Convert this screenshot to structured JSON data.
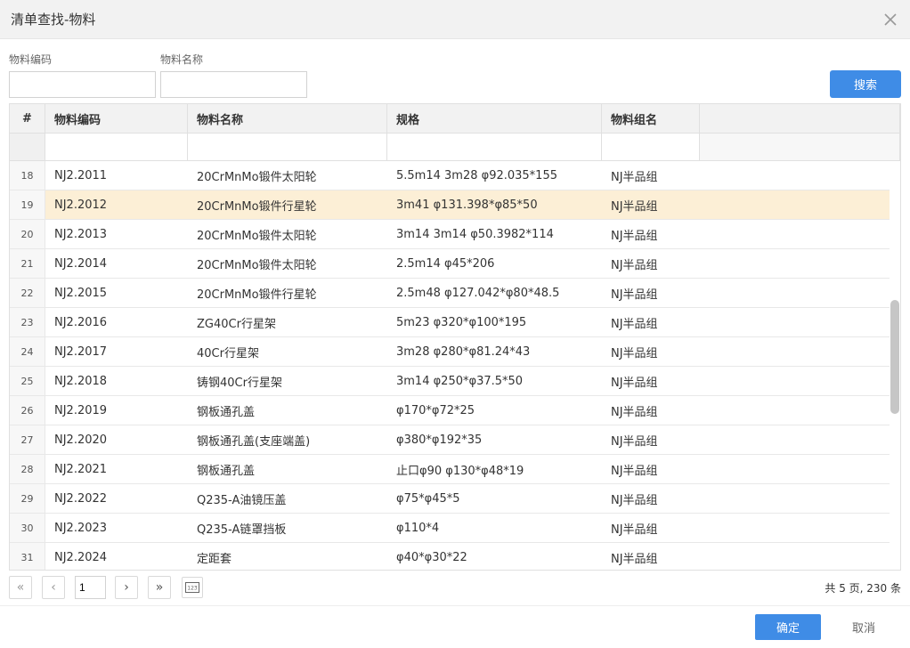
{
  "dialog": {
    "title": "清单查找-物料"
  },
  "filters": {
    "code_label": "物料编码",
    "code_value": "",
    "name_label": "物料名称",
    "name_value": "",
    "search_label": "搜索"
  },
  "table": {
    "columns": [
      "#",
      "物料编码",
      "物料名称",
      "规格",
      "物料组名"
    ],
    "rows": [
      {
        "no": "18",
        "code": "NJ2.2011",
        "name": "20CrMnMo锻件太阳轮",
        "spec": "5.5m14 3m28 φ92.035*155",
        "group": "NJ半品组"
      },
      {
        "no": "19",
        "code": "NJ2.2012",
        "name": "20CrMnMo锻件行星轮",
        "spec": "3m41 φ131.398*φ85*50",
        "group": "NJ半品组",
        "selected": true
      },
      {
        "no": "20",
        "code": "NJ2.2013",
        "name": "20CrMnMo锻件太阳轮",
        "spec": "3m14 3m14 φ50.3982*114",
        "group": "NJ半品组"
      },
      {
        "no": "21",
        "code": "NJ2.2014",
        "name": "20CrMnMo锻件太阳轮",
        "spec": "2.5m14 φ45*206",
        "group": "NJ半品组"
      },
      {
        "no": "22",
        "code": "NJ2.2015",
        "name": "20CrMnMo锻件行星轮",
        "spec": "2.5m48 φ127.042*φ80*48.5",
        "group": "NJ半品组"
      },
      {
        "no": "23",
        "code": "NJ2.2016",
        "name": "ZG40Cr行星架",
        "spec": "5m23 φ320*φ100*195",
        "group": "NJ半品组"
      },
      {
        "no": "24",
        "code": "NJ2.2017",
        "name": "40Cr行星架",
        "spec": "3m28 φ280*φ81.24*43",
        "group": "NJ半品组"
      },
      {
        "no": "25",
        "code": "NJ2.2018",
        "name": "铸钢40Cr行星架",
        "spec": "3m14 φ250*φ37.5*50",
        "group": "NJ半品组"
      },
      {
        "no": "26",
        "code": "NJ2.2019",
        "name": "钢板通孔盖",
        "spec": "φ170*φ72*25",
        "group": "NJ半品组"
      },
      {
        "no": "27",
        "code": "NJ2.2020",
        "name": "钢板通孔盖(支座端盖)",
        "spec": "φ380*φ192*35",
        "group": "NJ半品组"
      },
      {
        "no": "28",
        "code": "NJ2.2021",
        "name": "钢板通孔盖",
        "spec": "止口φ90 φ130*φ48*19",
        "group": "NJ半品组"
      },
      {
        "no": "29",
        "code": "NJ2.2022",
        "name": "Q235-A油镜压盖",
        "spec": "φ75*φ45*5",
        "group": "NJ半品组"
      },
      {
        "no": "30",
        "code": "NJ2.2023",
        "name": "Q235-A链罩挡板",
        "spec": "φ110*4",
        "group": "NJ半品组"
      },
      {
        "no": "31",
        "code": "NJ2.2024",
        "name": "定距套",
        "spec": "φ40*φ30*22",
        "group": "NJ半品组"
      }
    ]
  },
  "pager": {
    "page": "1",
    "total_text": "共 5 页, 230 条"
  },
  "footer": {
    "ok_label": "确定",
    "cancel_label": "取消"
  },
  "colors": {
    "primary": "#3f8ce6",
    "selected_row": "#fcefd6",
    "header_bg": "#f2f2f2"
  }
}
